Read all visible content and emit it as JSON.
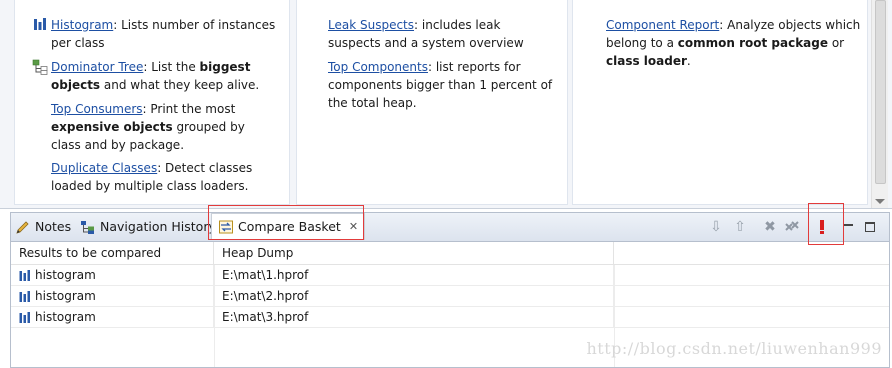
{
  "overview": {
    "col1": {
      "entries": [
        {
          "link": "Histogram",
          "text": ": Lists number of instances per class"
        },
        {
          "link": "Dominator Tree",
          "text_pre": ": List the ",
          "bold": "biggest objects",
          "text_post": " and what they keep alive."
        },
        {
          "link": "Top Consumers",
          "text_pre": ": Print the most ",
          "bold": "expensive objects",
          "text_post": " grouped by class and by package."
        },
        {
          "link": "Duplicate Classes",
          "text": ": Detect classes loaded by multiple class loaders."
        }
      ]
    },
    "col2": {
      "entries": [
        {
          "link": "Leak Suspects",
          "text": ": includes leak suspects and a system overview"
        },
        {
          "link": "Top Components",
          "text": ": list reports for components bigger than 1 percent of the total heap."
        }
      ]
    },
    "col3": {
      "entries": [
        {
          "link": "Component Report",
          "text_pre": ": Analyze objects which belong to a ",
          "bold": "common root package",
          "text_mid": " or ",
          "bold2": "class loader",
          "text_post": "."
        }
      ]
    }
  },
  "tabs": [
    {
      "label": "Notes"
    },
    {
      "label": "Navigation History"
    },
    {
      "label": "Compare Basket",
      "active": true
    }
  ],
  "table": {
    "headers": [
      "Results to be compared",
      "Heap Dump"
    ],
    "rows": [
      {
        "result": "histogram",
        "heap_dump": "E:\\mat\\1.hprof"
      },
      {
        "result": "histogram",
        "heap_dump": "E:\\mat\\2.hprof"
      },
      {
        "result": "histogram",
        "heap_dump": "E:\\mat\\3.hprof"
      }
    ]
  },
  "watermark": "http://blog.csdn.net/liuwenhan999",
  "colors": {
    "link": "#1d4fa3",
    "highlight": "#e23b3b",
    "compare_red": "#d81e1e"
  }
}
